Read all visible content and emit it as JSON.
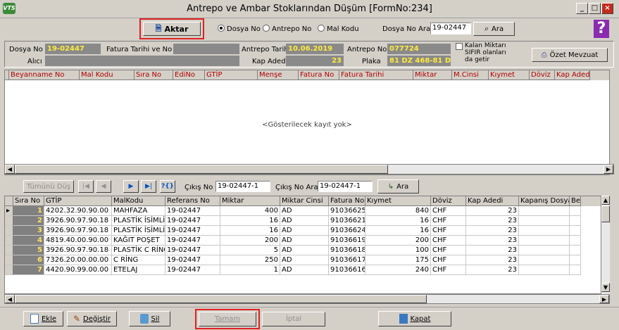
{
  "window": {
    "title": "Antrepo ve Ambar Stoklarından Düşüm [FormNo:234]",
    "logo": "VTS"
  },
  "toolbar": {
    "aktar_label": "Aktar",
    "radio_dosya": "Dosya No",
    "radio_antrepo": "Antrepo No",
    "radio_mal": "Mal Kodu",
    "search_label": "Dosya No Ara",
    "search_value": "19-02447",
    "ara_label": "Ara",
    "help": "?"
  },
  "info": {
    "dosya_no_label": "Dosya No",
    "dosya_no": "19-02447",
    "fatura_label": "Fatura Tarihi ve No",
    "alici_label": "Alıcı",
    "antrepo_tarihi_label": "Antrepo Tarihi",
    "antrepo_tarihi": "10.06.2019",
    "antrepo_no_label": "Antrepo No",
    "antrepo_no": "077724",
    "kap_adedi_label": "Kap Adedi",
    "kap_adedi": "23",
    "plaka_label": "Plaka",
    "plaka": "81 DZ 468-81 D",
    "kalan_label": "Kalan Miktarı SIFIR olanları da getir",
    "ozet_label": "Özet Mevzuat"
  },
  "upper_grid": {
    "columns": [
      "Beyanname No",
      "Mal Kodu",
      "Sıra No",
      "EdiNo",
      "GTİP",
      "Menşe",
      "Fatura No",
      "Fatura Tarihi",
      "Miktar",
      "M.Cinsi",
      "Kıymet",
      "Döviz",
      "Kap Adedi"
    ],
    "empty_text": "<Gösterilecek kayıt yok>"
  },
  "nav": {
    "tumunu_dus": "Tümünü Düş",
    "cikis_no_label": "Çıkış No",
    "cikis_no": "19-02447-1",
    "cikis_no_ara_label": "Çıkış No Ara",
    "cikis_no_ara": "19-02447-1",
    "ara_label": "Ara"
  },
  "lower_grid": {
    "columns": [
      "Sıra No",
      "GTİP",
      "MalKodu",
      "Referans No",
      "Miktar",
      "Miktar Cinsi",
      "Fatura No",
      "Kıymet",
      "Döviz",
      "Kap Adedi",
      "Kapanış Dosya No",
      "Be"
    ],
    "rows": [
      {
        "sira": "1",
        "gtip": "4202.32.90.90.00",
        "mal": "MAHFAZA",
        "ref": "19-02447",
        "miktar": "400",
        "cins": "AD",
        "fatura": "91036625",
        "kiymet": "840",
        "doviz": "CHF",
        "kap": "23"
      },
      {
        "sira": "2",
        "gtip": "3926.90.97.90.18",
        "mal": "PLASTİK İSİMLİK",
        "ref": "19-02447",
        "miktar": "16",
        "cins": "AD",
        "fatura": "91036621",
        "kiymet": "16",
        "doviz": "CHF",
        "kap": "23"
      },
      {
        "sira": "3",
        "gtip": "3926.90.97.90.18",
        "mal": "PLASTİK İSİMLİK",
        "ref": "19-02447",
        "miktar": "16",
        "cins": "AD",
        "fatura": "91036624",
        "kiymet": "16",
        "doviz": "CHF",
        "kap": "23"
      },
      {
        "sira": "4",
        "gtip": "4819.40.00.90.00",
        "mal": "KAĞIT POŞET",
        "ref": "19-02447",
        "miktar": "200",
        "cins": "AD",
        "fatura": "91036619",
        "kiymet": "200",
        "doviz": "CHF",
        "kap": "23"
      },
      {
        "sira": "5",
        "gtip": "3926.90.97.90.18",
        "mal": "PLASTİK C RİNG",
        "ref": "19-02447",
        "miktar": "5",
        "cins": "AD",
        "fatura": "91036618",
        "kiymet": "100",
        "doviz": "CHF",
        "kap": "23"
      },
      {
        "sira": "6",
        "gtip": "7326.20.00.00.00",
        "mal": "C RİNG",
        "ref": "19-02447",
        "miktar": "250",
        "cins": "AD",
        "fatura": "91036617",
        "kiymet": "175",
        "doviz": "CHF",
        "kap": "23"
      },
      {
        "sira": "7",
        "gtip": "4420.90.99.00.00",
        "mal": "ETELAJ",
        "ref": "19-02447",
        "miktar": "1",
        "cins": "AD",
        "fatura": "91036616",
        "kiymet": "240",
        "doviz": "CHF",
        "kap": "23"
      }
    ]
  },
  "bottom": {
    "ekle": "Ekle",
    "degistir": "Değiştir",
    "sil": "Sil",
    "tamam": "Tamam",
    "iptal": "İptal",
    "kapat": "Kapat"
  }
}
